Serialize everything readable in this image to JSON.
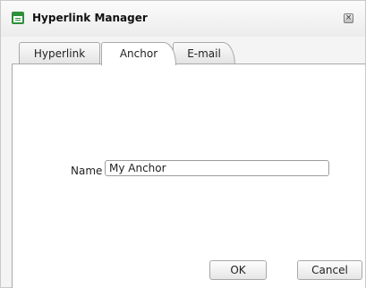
{
  "window": {
    "title": "Hyperlink Manager",
    "icon": "dialog-window-icon",
    "close_symbol": "×"
  },
  "tabs": [
    {
      "label": "Hyperlink",
      "active": false
    },
    {
      "label": "Anchor",
      "active": true
    },
    {
      "label": "E-mail",
      "active": false
    }
  ],
  "form": {
    "name_label": "Name",
    "name_value": "My Anchor"
  },
  "buttons": {
    "ok_label": "OK",
    "cancel_label": "Cancel"
  }
}
